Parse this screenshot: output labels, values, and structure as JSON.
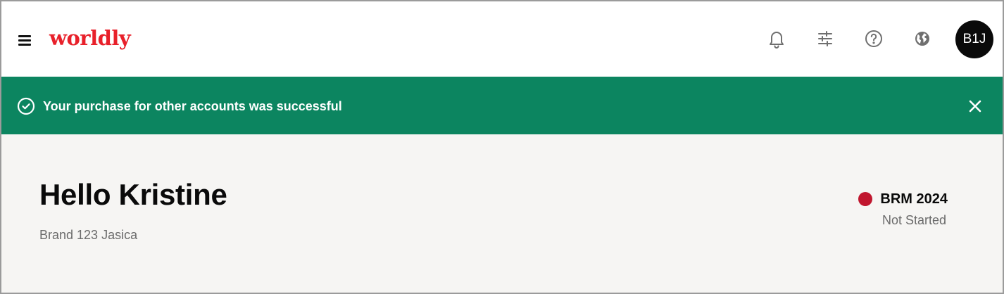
{
  "header": {
    "logo_text": "worldly",
    "menu_icon": "hamburger-menu-icon",
    "icons": [
      "bell-icon",
      "sliders-icon",
      "help-icon",
      "globe-icon"
    ],
    "avatar_initials": "B1J"
  },
  "banner": {
    "message": "Your purchase for other accounts was successful",
    "icon": "check-circle-icon",
    "close_icon": "close-icon",
    "background_color": "#0c8560"
  },
  "main": {
    "greeting": "Hello Kristine",
    "subtitle": "Brand 123 Jasica",
    "status": {
      "title": "BRM 2024",
      "state": "Not Started",
      "dot_color": "#c0162e"
    }
  },
  "colors": {
    "brand": "#e8202a",
    "page_background": "#f6f5f3"
  }
}
